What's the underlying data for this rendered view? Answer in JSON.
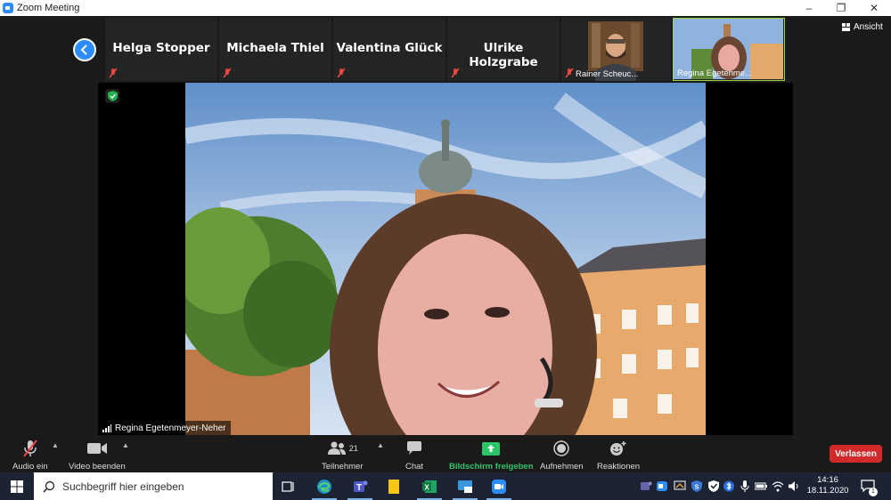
{
  "window": {
    "title": "Zoom Meeting",
    "controls": [
      "–",
      "❐",
      "✕"
    ]
  },
  "thumbnails": [
    {
      "name": "Helga Stopper"
    },
    {
      "name": "Michaela Thiel"
    },
    {
      "name": "Valentina Glück"
    },
    {
      "name": "Ulrike Holzgrabe"
    },
    {
      "name": "Rainer Scheuc..."
    },
    {
      "name": "Regina Egetenme..."
    }
  ],
  "view_button": {
    "label": "Ansicht"
  },
  "main_video": {
    "speaker": "Regina Egetenmeyer-Neher"
  },
  "toolbar": {
    "audio": "Audio ein",
    "video": "Video beenden",
    "participants": "Teilnehmer",
    "participants_count": "21",
    "chat": "Chat",
    "share": "Bildschirm freigeben",
    "record": "Aufnehmen",
    "reactions": "Reaktionen",
    "leave": "Verlassen"
  },
  "taskbar": {
    "search_placeholder": "Suchbegriff hier eingeben",
    "time": "14:16",
    "date": "18.11.2020",
    "notification_count": "1"
  },
  "colors": {
    "accent": "#2d8cff",
    "share_green": "#2dc46a",
    "leave_red": "#d22a2a",
    "active_speaker": "#9bd24a"
  }
}
